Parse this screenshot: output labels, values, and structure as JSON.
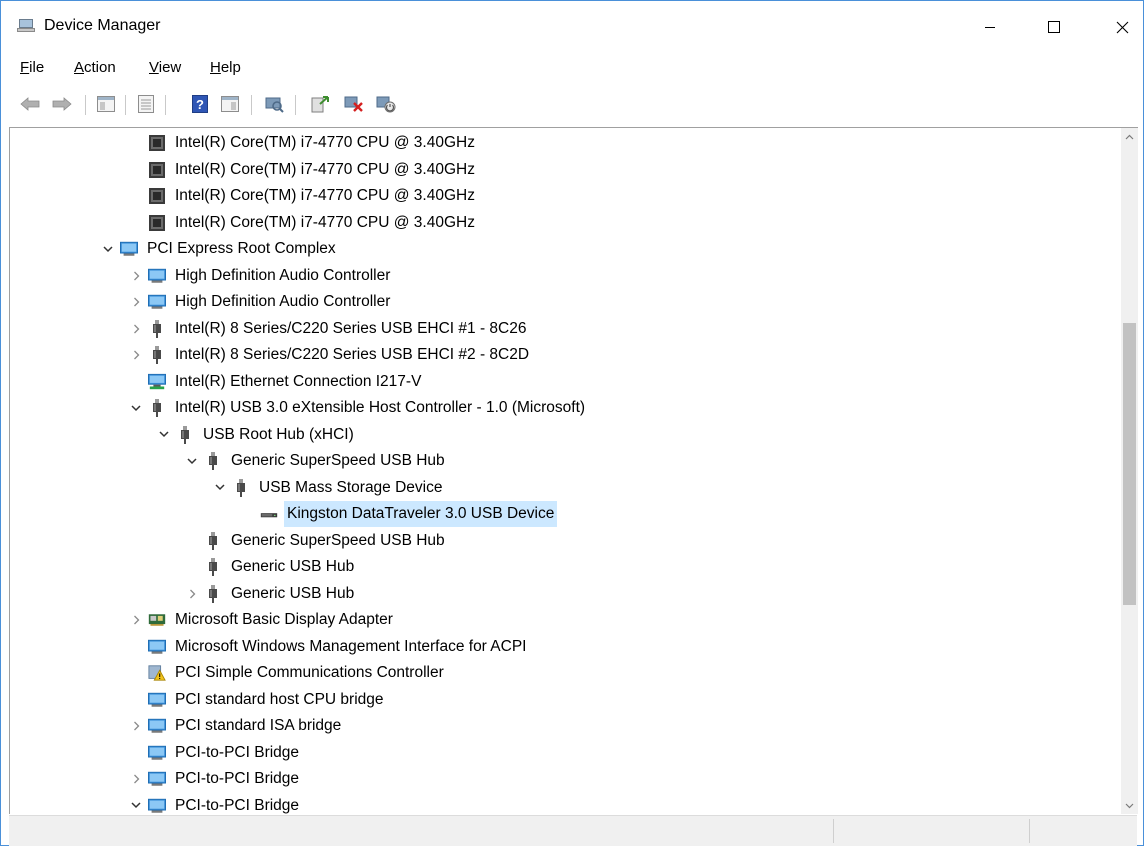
{
  "window": {
    "title": "Device Manager",
    "accent": "#4a90d9",
    "selection_color": "#cce8ff"
  },
  "caption_buttons": [
    {
      "name": "minimize-button",
      "icon": "minimize-icon"
    },
    {
      "name": "maximize-button",
      "icon": "maximize-icon"
    },
    {
      "name": "close-button",
      "icon": "close-icon"
    }
  ],
  "menu": {
    "file": "File",
    "action": "Action",
    "view": "View",
    "help": "Help"
  },
  "toolbar": [
    "back-icon",
    "forward-icon",
    "show-hide-console-tree-icon",
    "properties-icon",
    "help-icon",
    "show-hide-action-pane-icon",
    "scan-hardware-changes-icon",
    "update-driver-icon",
    "uninstall-device-icon",
    "enable-device-icon"
  ],
  "tree": [
    {
      "text": "Intel(R) Core(TM) i7-4770 CPU @ 3.40GHz",
      "level": 1,
      "expander": "none",
      "icon": "processor-icon"
    },
    {
      "text": "Intel(R) Core(TM) i7-4770 CPU @ 3.40GHz",
      "level": 1,
      "expander": "none",
      "icon": "processor-icon"
    },
    {
      "text": "Intel(R) Core(TM) i7-4770 CPU @ 3.40GHz",
      "level": 1,
      "expander": "none",
      "icon": "processor-icon"
    },
    {
      "text": "Intel(R) Core(TM) i7-4770 CPU @ 3.40GHz",
      "level": 1,
      "expander": "none",
      "icon": "processor-icon"
    },
    {
      "text": "PCI Express Root Complex",
      "level": 0,
      "expander": "expanded",
      "icon": "system-device-icon"
    },
    {
      "text": "High Definition Audio Controller",
      "level": 1,
      "expander": "collapsed",
      "icon": "system-device-icon"
    },
    {
      "text": "High Definition Audio Controller",
      "level": 1,
      "expander": "collapsed",
      "icon": "system-device-icon"
    },
    {
      "text": "Intel(R) 8 Series/C220 Series USB EHCI #1 - 8C26",
      "level": 1,
      "expander": "collapsed",
      "icon": "usb-plug-icon"
    },
    {
      "text": "Intel(R) 8 Series/C220 Series USB EHCI #2 - 8C2D",
      "level": 1,
      "expander": "collapsed",
      "icon": "usb-plug-icon"
    },
    {
      "text": "Intel(R) Ethernet Connection I217-V",
      "level": 1,
      "expander": "none",
      "icon": "network-adapter-icon"
    },
    {
      "text": "Intel(R) USB 3.0 eXtensible Host Controller - 1.0 (Microsoft)",
      "level": 1,
      "expander": "expanded",
      "icon": "usb-plug-icon"
    },
    {
      "text": "USB Root Hub (xHCI)",
      "level": 2,
      "expander": "expanded",
      "icon": "usb-plug-icon"
    },
    {
      "text": "Generic SuperSpeed USB Hub",
      "level": 3,
      "expander": "expanded",
      "icon": "usb-plug-icon"
    },
    {
      "text": "USB Mass Storage Device",
      "level": 4,
      "expander": "expanded",
      "icon": "usb-plug-icon"
    },
    {
      "text": "Kingston DataTraveler 3.0 USB Device",
      "level": 5,
      "expander": "none",
      "icon": "disk-drive-icon",
      "selected": true
    },
    {
      "text": "Generic SuperSpeed USB Hub",
      "level": 3,
      "expander": "none",
      "icon": "usb-plug-icon"
    },
    {
      "text": "Generic USB Hub",
      "level": 3,
      "expander": "none",
      "icon": "usb-plug-icon"
    },
    {
      "text": "Generic USB Hub",
      "level": 3,
      "expander": "collapsed",
      "icon": "usb-plug-icon"
    },
    {
      "text": "Microsoft Basic Display Adapter",
      "level": 1,
      "expander": "collapsed",
      "icon": "display-adapter-icon"
    },
    {
      "text": "Microsoft Windows Management Interface for ACPI",
      "level": 1,
      "expander": "none",
      "icon": "system-device-icon"
    },
    {
      "text": "PCI Simple Communications Controller",
      "level": 1,
      "expander": "none",
      "icon": "warning-device-icon"
    },
    {
      "text": "PCI standard host CPU bridge",
      "level": 1,
      "expander": "none",
      "icon": "system-device-icon"
    },
    {
      "text": "PCI standard ISA bridge",
      "level": 1,
      "expander": "collapsed",
      "icon": "system-device-icon"
    },
    {
      "text": "PCI-to-PCI Bridge",
      "level": 1,
      "expander": "none",
      "icon": "system-device-icon"
    },
    {
      "text": "PCI-to-PCI Bridge",
      "level": 1,
      "expander": "collapsed",
      "icon": "system-device-icon"
    },
    {
      "text": "PCI-to-PCI Bridge",
      "level": 1,
      "expander": "expanded",
      "icon": "system-device-icon"
    }
  ]
}
